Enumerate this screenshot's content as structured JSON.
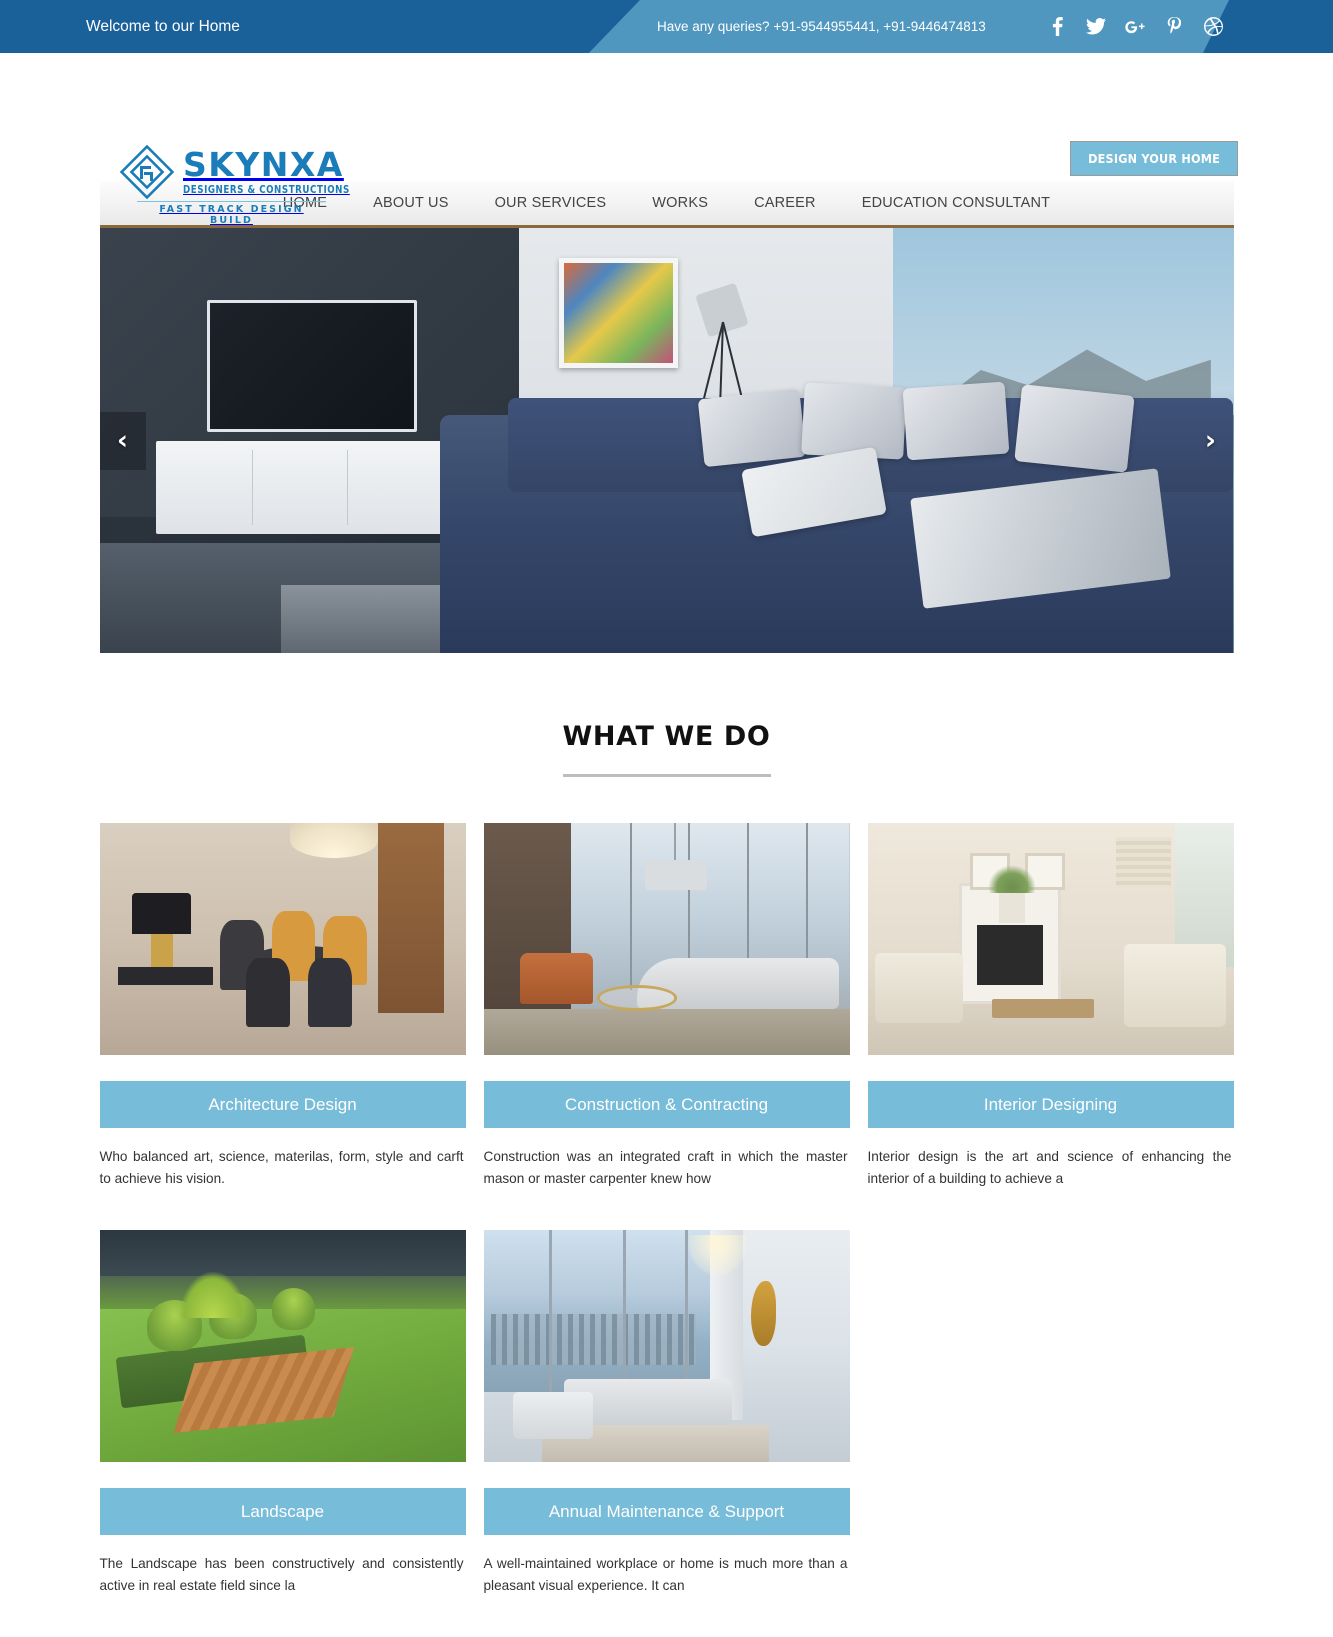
{
  "topbar": {
    "welcome": "Welcome to our Home",
    "queries": "Have any queries? +91-9544955441, +91-9446474813",
    "social": [
      {
        "name": "facebook-icon",
        "glyph": "f"
      },
      {
        "name": "twitter-icon",
        "glyph": "twitter"
      },
      {
        "name": "google-plus-icon",
        "glyph": "G+"
      },
      {
        "name": "pinterest-icon",
        "glyph": "P"
      },
      {
        "name": "dribbble-icon",
        "glyph": "dribbble"
      }
    ],
    "bg_dark": "#1a6099",
    "bg_light": "#4f97bf"
  },
  "header": {
    "logo": {
      "name": "SKYNXA",
      "subtitle": "DESIGNERS & CONSTRUCTIONS",
      "tagline": "FAST TRACK DESIGN BUILD",
      "color": "#1a7cb8"
    },
    "cta_label": "DESIGN YOUR HOME",
    "cta_color": "#77bcd8"
  },
  "nav": {
    "items": [
      {
        "label": "HOME"
      },
      {
        "label": "ABOUT US"
      },
      {
        "label": "OUR SERVICES"
      },
      {
        "label": "WORKS"
      },
      {
        "label": "CAREER"
      },
      {
        "label": "EDUCATION CONSULTANT"
      }
    ],
    "underline_color": "#8a6a3d"
  },
  "hero": {
    "prev_label": "‹",
    "next_label": "›",
    "alt": "Modern living room with blue sectional sofa, wall-mounted TV and ocean view windows"
  },
  "main": {
    "section_title": "WHAT WE DO",
    "services": [
      {
        "title": "Architecture Design",
        "desc": "Who balanced art, science, materilas, form, style and carft to achieve his vision.",
        "image_alt": "Dining room with black and orange chairs"
      },
      {
        "title": "Construction & Contracting",
        "desc": "Construction was an integrated craft in which the master mason or master carpenter knew how",
        "image_alt": "Modern lounge with floor to ceiling windows"
      },
      {
        "title": "Interior Designing",
        "desc": "Interior design is the art and science of enhancing the interior of a building to achieve a",
        "image_alt": "Classic living room with fireplace"
      },
      {
        "title": "Landscape",
        "desc": "The Landscape has been constructively and consistently active in real estate field since la",
        "image_alt": "Landscaped garden with lawn and timber path"
      },
      {
        "title": "Annual Maintenance & Support",
        "desc": "A well-maintained workplace or home is much more than a pleasant visual experience. It can",
        "image_alt": "Penthouse living room with city view"
      }
    ],
    "card_title_bg": "#77bcd8"
  }
}
